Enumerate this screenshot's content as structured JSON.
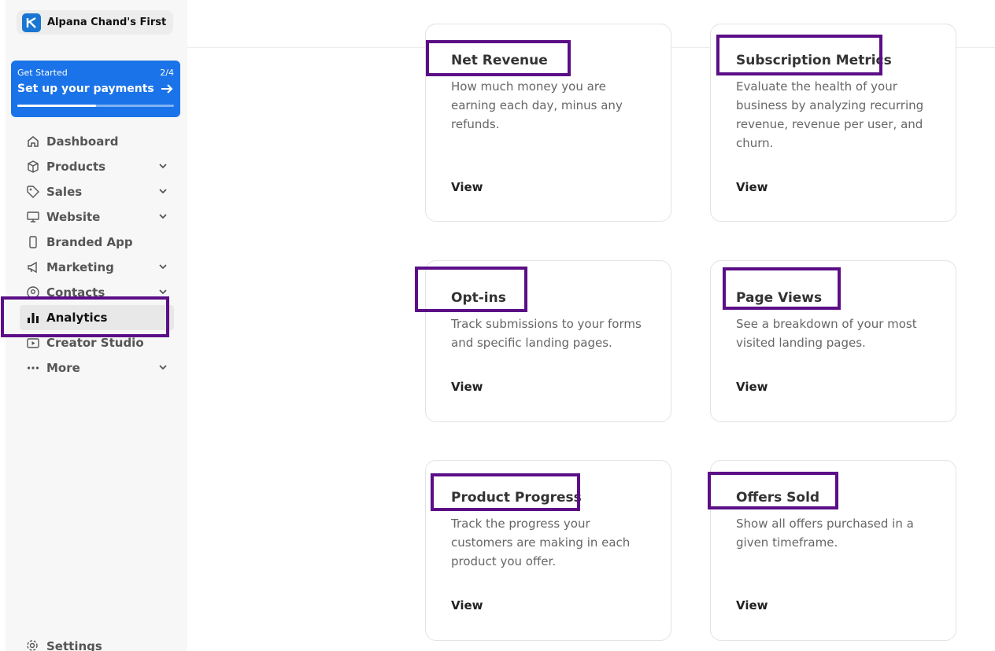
{
  "brand": {
    "name": "Alpana Chand's First",
    "logo_icon": "kajabi-logo-icon",
    "logo_color": "#1976d2"
  },
  "get_started": {
    "label": "Get Started",
    "progress_text": "2/4",
    "title": "Set up your payments",
    "progress_fraction": 0.5,
    "color": "#1a73e8"
  },
  "sidebar": {
    "items": [
      {
        "label": "Dashboard",
        "icon": "home-icon",
        "has_chevron": false
      },
      {
        "label": "Products",
        "icon": "box-icon",
        "has_chevron": true
      },
      {
        "label": "Sales",
        "icon": "tag-icon",
        "has_chevron": true
      },
      {
        "label": "Website",
        "icon": "monitor-icon",
        "has_chevron": true
      },
      {
        "label": "Branded App",
        "icon": "phone-icon",
        "has_chevron": false
      },
      {
        "label": "Marketing",
        "icon": "megaphone-icon",
        "has_chevron": true
      },
      {
        "label": "Contacts",
        "icon": "contact-icon",
        "has_chevron": true
      },
      {
        "label": "Analytics",
        "icon": "bar-chart-icon",
        "has_chevron": false,
        "active": true
      },
      {
        "label": "Creator Studio",
        "icon": "video-icon",
        "has_chevron": false
      },
      {
        "label": "More",
        "icon": "dots-icon",
        "has_chevron": true
      }
    ],
    "settings_label": "Settings"
  },
  "cards": [
    {
      "title": "Net Revenue",
      "description": "How much money you are earning each day, minus any refunds.",
      "action": "View"
    },
    {
      "title": "Subscription Metrics",
      "description": "Evaluate the health of your business by analyzing recurring revenue, revenue per user, and churn.",
      "action": "View"
    },
    {
      "title": "Opt-ins",
      "description": "Track submissions to your forms and specific landing pages.",
      "action": "View"
    },
    {
      "title": "Page Views",
      "description": "See a breakdown of your most visited landing pages.",
      "action": "View"
    },
    {
      "title": "Product Progress",
      "description": "Track the progress your customers are making in each product you offer.",
      "action": "View"
    },
    {
      "title": "Offers Sold",
      "description": "Show all offers purchased in a given timeframe.",
      "action": "View"
    }
  ],
  "colors": {
    "highlight": "#5b0e86",
    "active_nav_bg": "#e8e8e8"
  }
}
